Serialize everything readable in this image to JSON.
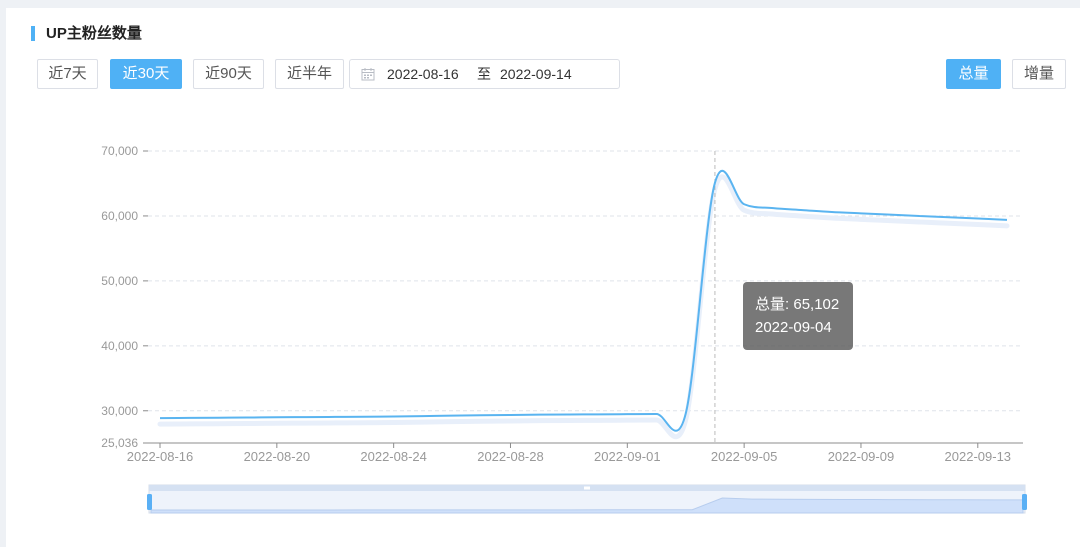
{
  "title": "UP主粉丝数量",
  "range_buttons": [
    {
      "label": "近7天",
      "active": false
    },
    {
      "label": "近30天",
      "active": true
    },
    {
      "label": "近90天",
      "active": false
    },
    {
      "label": "近半年",
      "active": false
    }
  ],
  "date_range": {
    "start": "2022-08-16",
    "separator": "至",
    "end": "2022-09-14"
  },
  "mode_buttons": [
    {
      "label": "总量",
      "active": true
    },
    {
      "label": "增量",
      "active": false
    }
  ],
  "icons": {
    "date_picker": "calendar-icon"
  },
  "colors": {
    "accent": "#4fb1f5",
    "line": "#5ab4f0",
    "grid": "#dfe3ea"
  },
  "tooltip": {
    "label": "总量",
    "value": "65,102",
    "date": "2022-09-04"
  },
  "chart_data": {
    "type": "line",
    "title": "",
    "xlabel": "",
    "ylabel": "",
    "x": [
      "2022-08-16",
      "2022-08-17",
      "2022-08-18",
      "2022-08-19",
      "2022-08-20",
      "2022-08-21",
      "2022-08-22",
      "2022-08-23",
      "2022-08-24",
      "2022-08-25",
      "2022-08-26",
      "2022-08-27",
      "2022-08-28",
      "2022-08-29",
      "2022-08-30",
      "2022-08-31",
      "2022-09-01",
      "2022-09-02",
      "2022-09-03",
      "2022-09-04",
      "2022-09-05",
      "2022-09-06",
      "2022-09-07",
      "2022-09-08",
      "2022-09-09",
      "2022-09-10",
      "2022-09-11",
      "2022-09-12",
      "2022-09-13",
      "2022-09-14"
    ],
    "series": [
      {
        "name": "总量",
        "values": [
          28870,
          28900,
          28930,
          28960,
          29000,
          29020,
          29050,
          29080,
          29120,
          29180,
          29250,
          29300,
          29350,
          29400,
          29430,
          29450,
          29480,
          29510,
          29560,
          65102,
          61800,
          61200,
          60900,
          60600,
          60400,
          60200,
          60000,
          59800,
          59600,
          59400
        ]
      }
    ],
    "y_ticks": [
      25036,
      30000,
      40000,
      50000,
      60000,
      70000
    ],
    "y_tick_labels": [
      "25,036",
      "30,000",
      "40,000",
      "50,000",
      "60,000",
      "70,000"
    ],
    "x_tick_labels": [
      "2022-08-16",
      "2022-08-20",
      "2022-08-24",
      "2022-08-28",
      "2022-09-01",
      "2022-09-05",
      "2022-09-09",
      "2022-09-13"
    ],
    "ylim": [
      25036,
      70000
    ],
    "grid": true,
    "highlight": {
      "x": "2022-09-04",
      "value": 65102
    }
  }
}
